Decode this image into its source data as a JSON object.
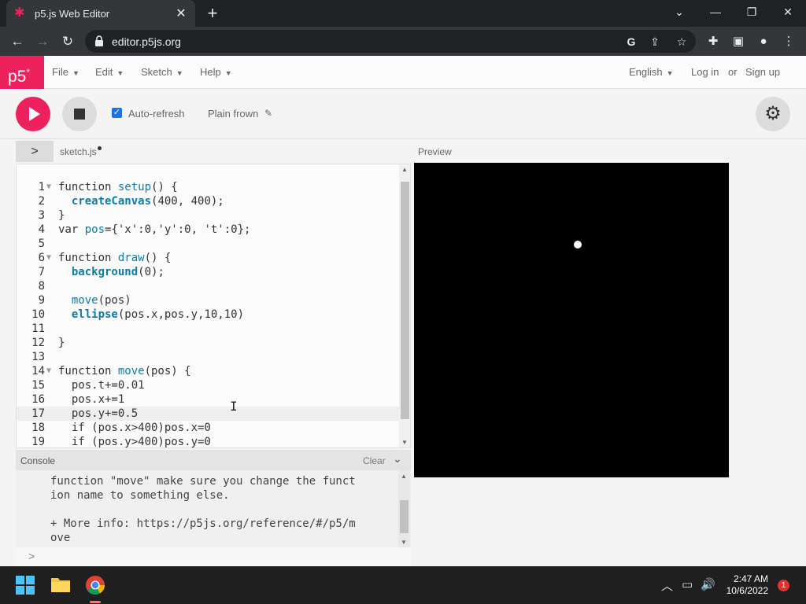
{
  "browser": {
    "tab_title": "p5.js Web Editor",
    "url": "editor.p5js.org"
  },
  "nav": {
    "logo": "p5",
    "logo_sup": "*",
    "menus": [
      "File",
      "Edit",
      "Sketch",
      "Help"
    ],
    "language": "English",
    "login": "Log in",
    "or": "or",
    "signup": "Sign up"
  },
  "toolbar": {
    "auto_refresh_label": "Auto-refresh",
    "auto_refresh_checked": true,
    "sketch_name": "Plain frown"
  },
  "editor": {
    "file_name": "sketch.js",
    "preview_label": "Preview",
    "active_line": 17,
    "lines": [
      {
        "n": "1",
        "text": "function setup() {"
      },
      {
        "n": "2",
        "text": "  createCanvas(400, 400);"
      },
      {
        "n": "3",
        "text": "}"
      },
      {
        "n": "4",
        "text": "var pos={'x':0,'y':0, 't':0};"
      },
      {
        "n": "5",
        "text": ""
      },
      {
        "n": "6",
        "text": "function draw() {"
      },
      {
        "n": "7",
        "text": "  background(0);"
      },
      {
        "n": "8",
        "text": ""
      },
      {
        "n": "9",
        "text": "  move(pos)"
      },
      {
        "n": "10",
        "text": "  ellipse(pos.x,pos.y,10,10)"
      },
      {
        "n": "11",
        "text": ""
      },
      {
        "n": "12",
        "text": "}"
      },
      {
        "n": "13",
        "text": ""
      },
      {
        "n": "14",
        "text": "function move(pos) {"
      },
      {
        "n": "15",
        "text": "  pos.t+=0.01"
      },
      {
        "n": "16",
        "text": "  pos.x+=1"
      },
      {
        "n": "17",
        "text": "  pos.y+=0.5"
      },
      {
        "n": "18",
        "text": "  if (pos.x>400)pos.x=0"
      },
      {
        "n": "19",
        "text": "  if (pos.y>400)pos.y=0"
      }
    ]
  },
  "console": {
    "title": "Console",
    "clear": "Clear",
    "lines": [
      "function \"move\" make sure you change the funct",
      "ion name to something else.",
      "",
      "+ More info: https://p5js.org/reference/#/p5/m",
      "ove"
    ],
    "prompt": ">"
  },
  "taskbar": {
    "time": "2:47 AM",
    "date": "10/6/2022",
    "notifications": "1"
  }
}
